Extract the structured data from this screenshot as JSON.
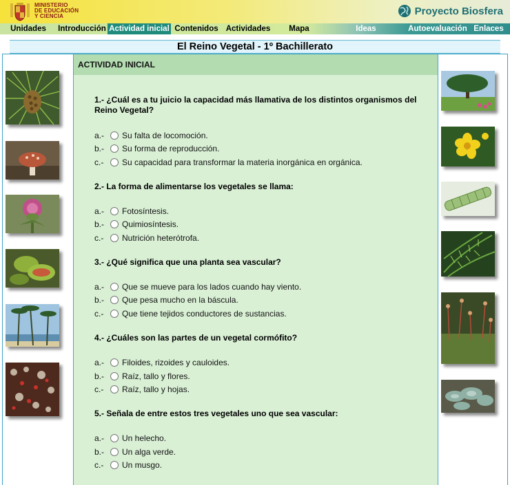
{
  "header": {
    "ministry_lines": [
      "MINISTERIO",
      "DE EDUCACIÓN",
      "Y CIENCIA"
    ],
    "brand": "Proyecto Biosfera"
  },
  "nav": [
    {
      "label": "Unidades"
    },
    {
      "label": "Introducción"
    },
    {
      "label": "Actividad inicial",
      "active": true
    },
    {
      "label": "Contenidos"
    },
    {
      "label": "Actividades"
    },
    {
      "label": "Mapa"
    },
    {
      "label": "Ideas"
    },
    {
      "label": "Autoevaluación"
    },
    {
      "label": "Enlaces"
    }
  ],
  "page_title": "El Reino Vegetal   -  1º Bachillerato",
  "section_title": "ACTIVIDAD INICIAL",
  "questions": [
    {
      "text": "1.- ¿Cuál es a tu juicio la capacidad más llamativa de los distintos organismos del Reino Vegetal?",
      "options": [
        {
          "letter": "a.-",
          "text": "Su falta de locomoción."
        },
        {
          "letter": "b.-",
          "text": "Su forma de reproducción."
        },
        {
          "letter": "c.-",
          "text": "Su capacidad para transformar la materia inorgánica en orgánica."
        }
      ]
    },
    {
      "text": "2.- La forma de alimentarse los vegetales se llama:",
      "options": [
        {
          "letter": "a.-",
          "text": "Fotosíntesis."
        },
        {
          "letter": "b.-",
          "text": "Quimiosíntesis."
        },
        {
          "letter": "c.-",
          "text": "Nutrición heterótrofa."
        }
      ]
    },
    {
      "text": "3.- ¿Qué significa que una planta sea vascular?",
      "options": [
        {
          "letter": "a.-",
          "text": "Que se mueve para los lados cuando hay viento."
        },
        {
          "letter": "b.-",
          "text": "Que pesa mucho en la báscula."
        },
        {
          "letter": "c.-",
          "text": "Que tiene tejidos conductores de sustancias."
        }
      ]
    },
    {
      "text": "4.- ¿Cuáles son las partes de un vegetal cormófito?",
      "options": [
        {
          "letter": "a.-",
          "text": "Filoides, rizoides y cauloides."
        },
        {
          "letter": "b.-",
          "text": "Raíz, tallo y flores."
        },
        {
          "letter": "c.-",
          "text": "Raíz, tallo y hojas."
        }
      ]
    },
    {
      "text": "5.- Señala de entre estos tres vegetales uno que sea vascular:",
      "options": [
        {
          "letter": "a.-",
          "text": "Un helecho."
        },
        {
          "letter": "b.-",
          "text": "Un alga verde."
        },
        {
          "letter": "c.-",
          "text": "Un musgo."
        }
      ]
    }
  ],
  "photos": {
    "left": [
      "pine-cone-photo",
      "mushroom-photo",
      "thistle-photo",
      "venus-flytrap-photo",
      "palm-trees-photo",
      "lichen-photo"
    ],
    "right": [
      "tree-landscape-photo",
      "yellow-flower-photo",
      "algae-micrograph-photo",
      "fern-photo",
      "moss-photo",
      "succulent-photo"
    ]
  },
  "colors": {
    "content_bg": "#d9f0d5",
    "section_header_bg": "#b3dcb0",
    "nav_active": "#1f8b7d",
    "brand": "#1e6f73",
    "border": "#3a9fc4"
  }
}
